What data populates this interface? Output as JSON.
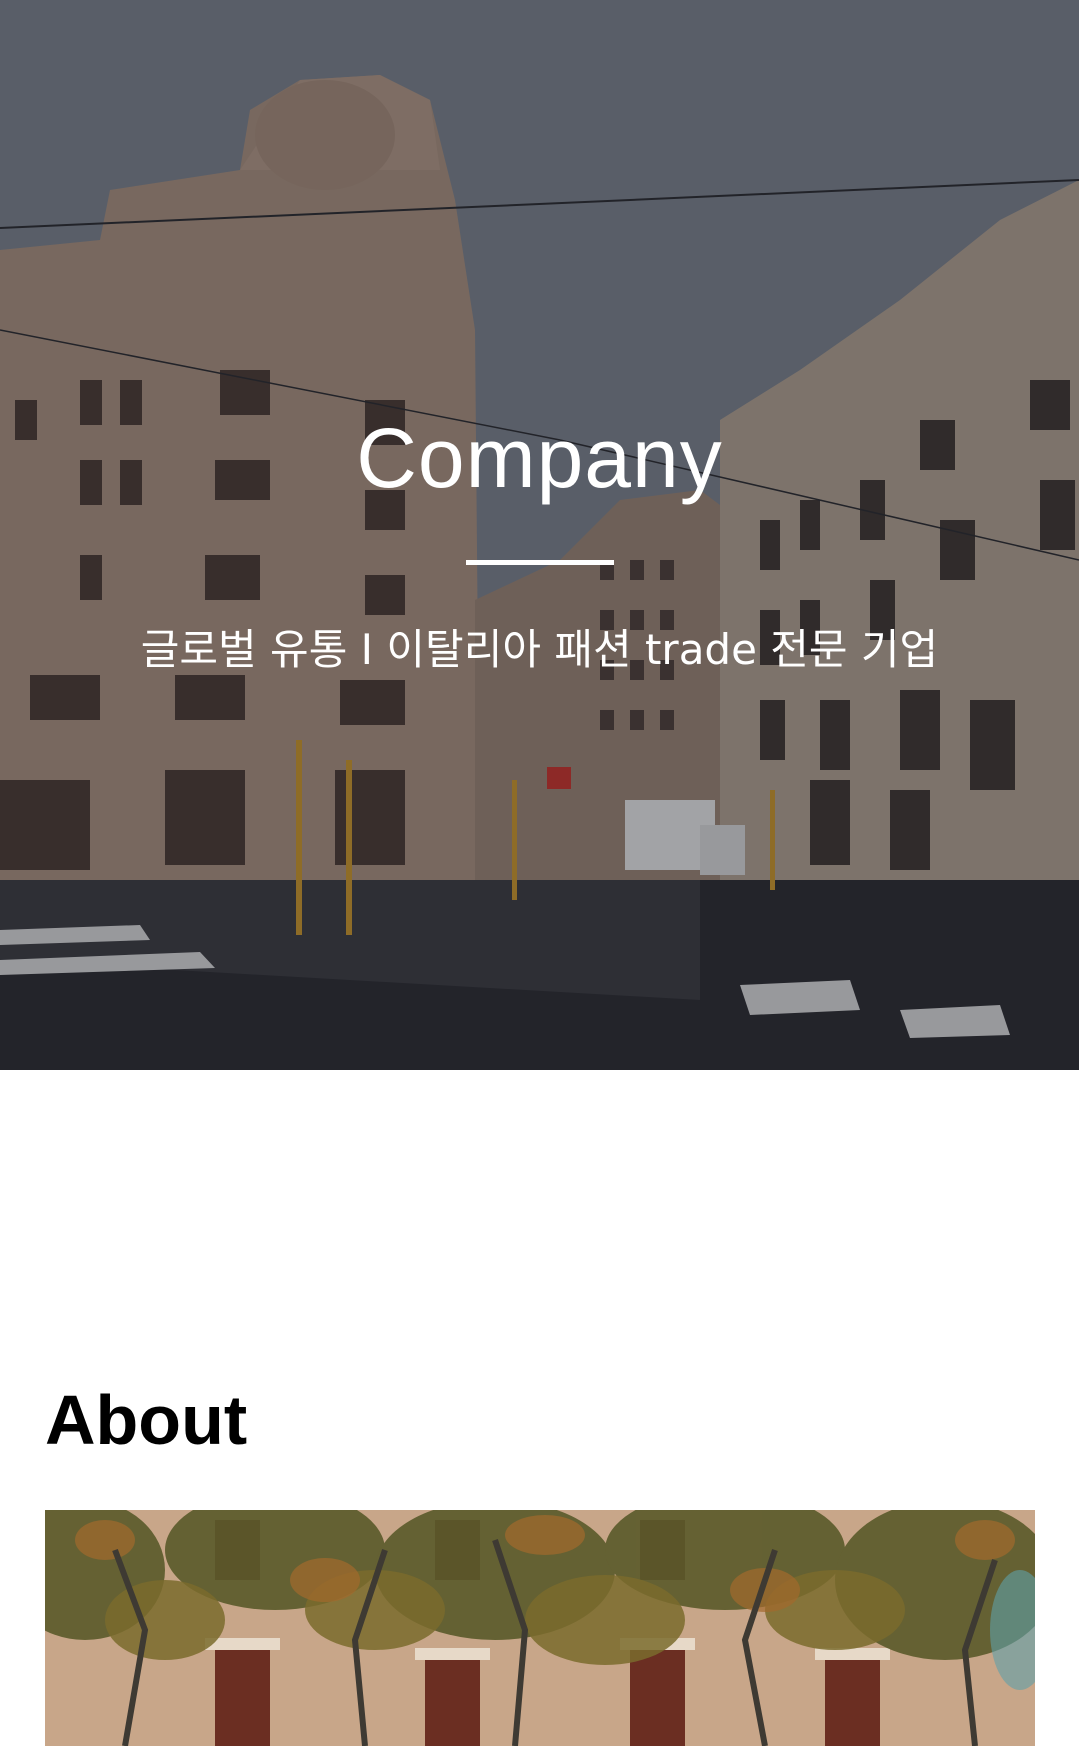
{
  "hero": {
    "title": "Company",
    "subtitle": "글로벌 유통 I 이탈리아 패션 trade 전문 기업",
    "image": "milan-street-buildings-photo"
  },
  "about": {
    "heading": "About",
    "image": "building-with-trees-photo"
  },
  "colors": {
    "hero_text": "#ffffff",
    "heading_text": "#000000",
    "background": "#ffffff"
  }
}
